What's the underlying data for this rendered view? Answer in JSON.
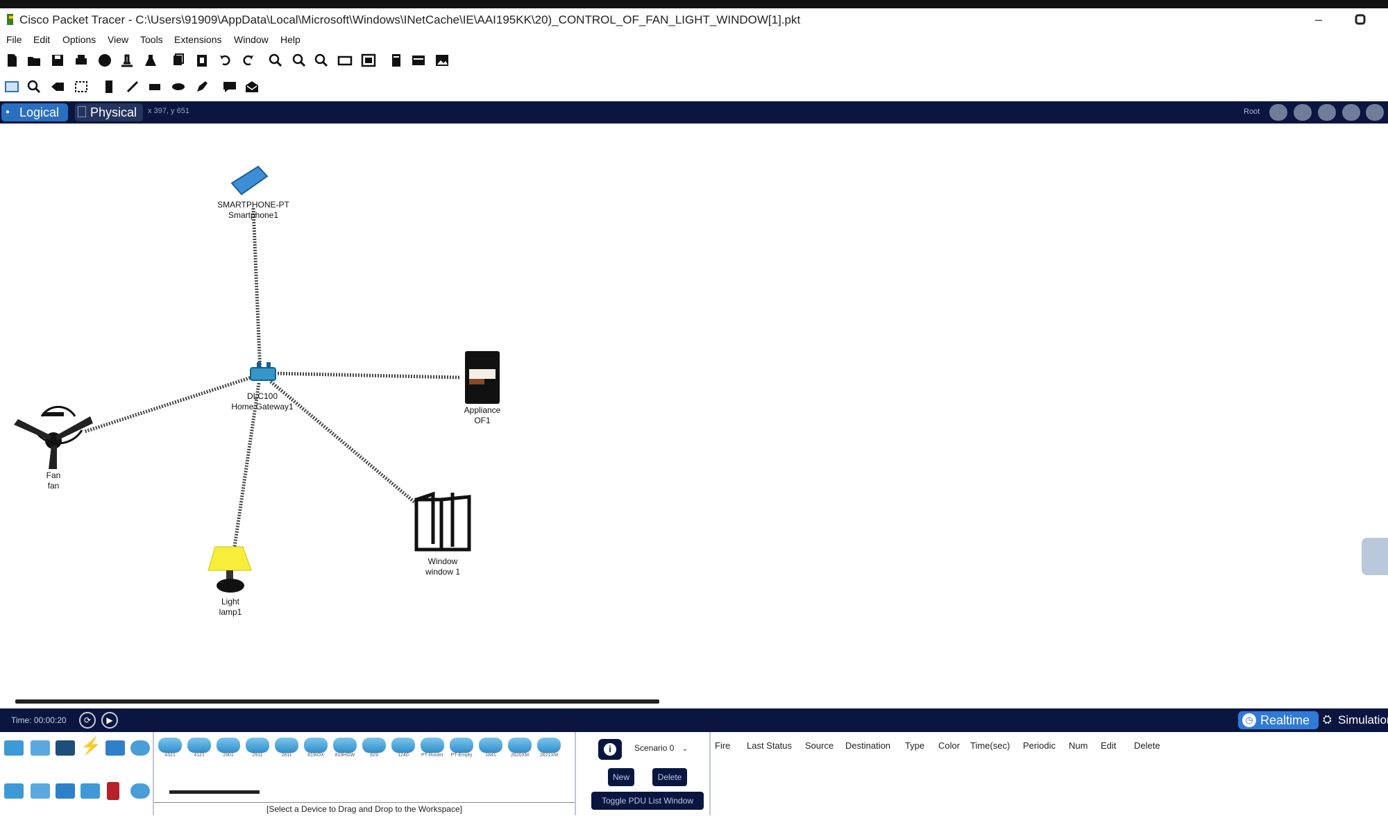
{
  "window": {
    "title": "Cisco Packet Tracer - C:\\Users\\91909\\AppData\\Local\\Microsoft\\Windows\\INetCache\\IE\\AAI195KK\\20)_CONTROL_OF_FAN_LIGHT_WINDOW[1].pkt",
    "minimize": "–"
  },
  "menu": [
    "File",
    "Edit",
    "Options",
    "View",
    "Tools",
    "Extensions",
    "Window",
    "Help"
  ],
  "viewbar": {
    "logical": "Logical",
    "physical": "Physical",
    "coords": "x 397, y 651",
    "root": "Root"
  },
  "devices": {
    "smartphone": {
      "type": "SMARTPHONE-PT",
      "name": "Smartphone1"
    },
    "gateway": {
      "type": "DLC100",
      "name": "Home Gateway1"
    },
    "appliance": {
      "type": "Appliance",
      "name": "OF1"
    },
    "fan": {
      "type": "Fan",
      "name": "fan"
    },
    "light": {
      "type": "Light",
      "name": "lamp1"
    },
    "window": {
      "type": "Window",
      "name": "window 1"
    }
  },
  "statusbar": {
    "time": "Time: 00:00:20",
    "realtime": "Realtime",
    "simulation": "Simulation"
  },
  "device_list": {
    "models": [
      "4321",
      "4121",
      "2901",
      "2911",
      "2811",
      "819IOX",
      "819HGW",
      "829",
      "1240",
      "PT-Router",
      "PT-Empty",
      "1841",
      "2620XM",
      "2621XM"
    ],
    "hint": "[Select a Device to Drag and Drop to the Workspace]"
  },
  "scenario": {
    "selected": "Scenario 0",
    "new": "New",
    "delete": "Delete",
    "toggle": "Toggle PDU List Window"
  },
  "pdu_columns": [
    "Fire",
    "Last Status",
    "Source",
    "Destination",
    "Type",
    "Color",
    "Time(sec)",
    "Periodic",
    "Num",
    "Edit",
    "Delete"
  ]
}
